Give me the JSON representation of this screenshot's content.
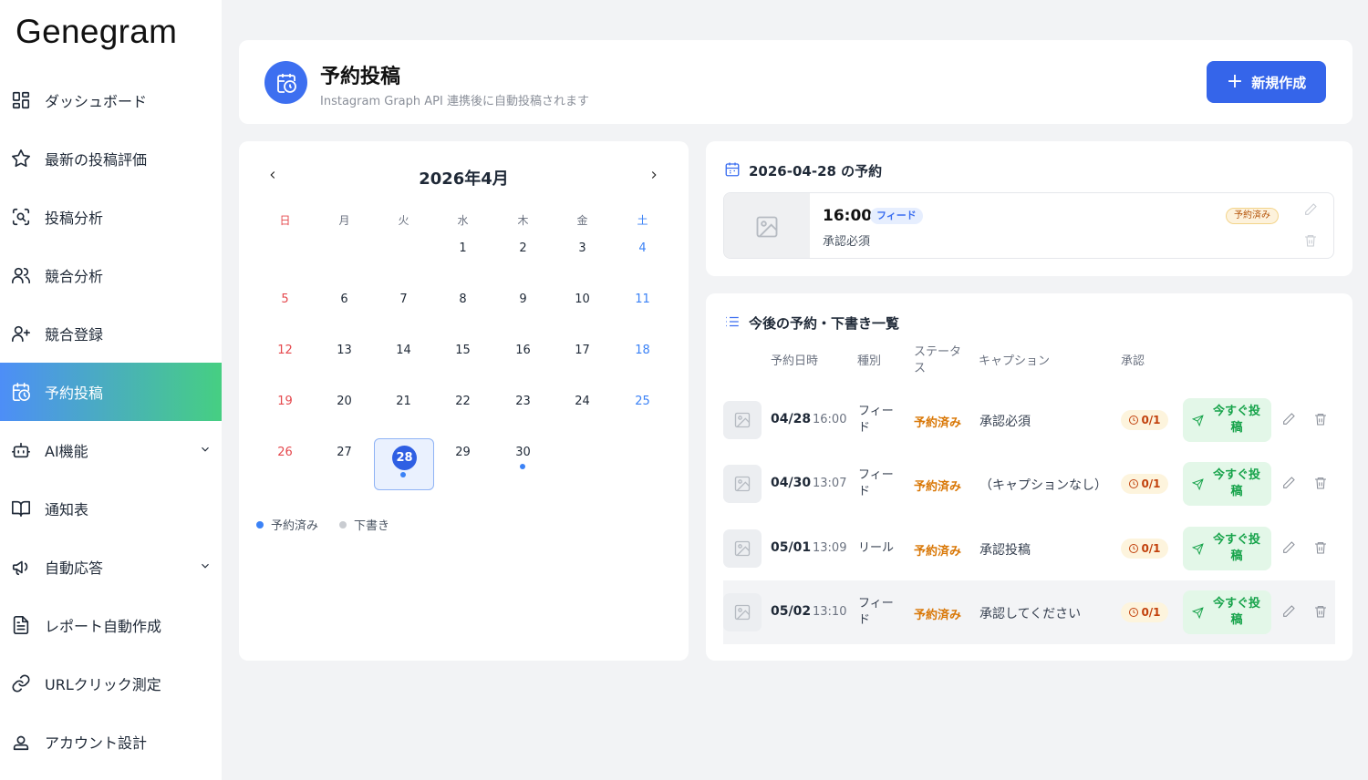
{
  "app": {
    "logo": "Genegram"
  },
  "sidebar": {
    "items": [
      {
        "label": "ダッシュボード",
        "icon": "dashboard-icon"
      },
      {
        "label": "最新の投稿評価",
        "icon": "star-icon"
      },
      {
        "label": "投稿分析",
        "icon": "scan-icon"
      },
      {
        "label": "競合分析",
        "icon": "users-icon"
      },
      {
        "label": "競合登録",
        "icon": "user-plus-icon"
      },
      {
        "label": "予約投稿",
        "icon": "calendar-clock-icon",
        "active": true
      },
      {
        "label": "AI機能",
        "icon": "bot-icon",
        "expandable": true
      },
      {
        "label": "通知表",
        "icon": "book-icon"
      },
      {
        "label": "自動応答",
        "icon": "megaphone-icon",
        "expandable": true
      },
      {
        "label": "レポート自動作成",
        "icon": "file-text-icon"
      },
      {
        "label": "URLクリック測定",
        "icon": "link-icon"
      },
      {
        "label": "アカウント設計",
        "icon": "user-square-icon"
      }
    ],
    "active_gradient": [
      "#4d8ef7",
      "#46cf82"
    ]
  },
  "header": {
    "title": "予約投稿",
    "subtitle": "Instagram Graph API 連携後に自動投稿されます",
    "new_button": "新規作成",
    "new_button_icon": "plus-icon"
  },
  "calendar": {
    "month_label": "2026年4月",
    "weekdays": [
      "日",
      "月",
      "火",
      "水",
      "木",
      "金",
      "土"
    ],
    "days": [
      "1",
      "2",
      "3",
      "4",
      "5",
      "6",
      "7",
      "8",
      "9",
      "10",
      "11",
      "12",
      "13",
      "14",
      "15",
      "16",
      "17",
      "18",
      "19",
      "20",
      "21",
      "22",
      "23",
      "24",
      "25",
      "26",
      "27",
      "28",
      "29",
      "30"
    ],
    "selected_day": "28",
    "legend": {
      "scheduled": "予約済み",
      "draft": "下書き"
    },
    "colors": {
      "scheduled": "#3b82f6",
      "draft": "#c9ccd1",
      "sunday": "#e5484d",
      "saturday": "#3b82f6"
    }
  },
  "day_reservations": {
    "title": "2026-04-28 の予約",
    "item": {
      "time": "16:00",
      "type": "フィード",
      "caption": "承認必須",
      "status": "予約済み"
    }
  },
  "upcoming": {
    "title": "今後の予約・下書き一覧",
    "columns": {
      "datetime": "予約日時",
      "type": "種別",
      "status": "ステータス",
      "caption": "キャプション",
      "approval": "承認"
    },
    "post_now_label": "今すぐ投稿",
    "rows": [
      {
        "date": "04/28",
        "time": "16:00",
        "type": "フィード",
        "status": "予約済み",
        "caption": "承認必須",
        "approval": "0/1"
      },
      {
        "date": "04/30",
        "time": "13:07",
        "type": "フィード",
        "status": "予約済み",
        "caption": "（キャプションなし）",
        "approval": "0/1"
      },
      {
        "date": "05/01",
        "time": "13:09",
        "type": "リール",
        "status": "予約済み",
        "caption": "承認投稿",
        "approval": "0/1"
      },
      {
        "date": "05/02",
        "time": "13:10",
        "type": "フィード",
        "status": "予約済み",
        "caption": "承認してください",
        "approval": "0/1"
      }
    ]
  }
}
